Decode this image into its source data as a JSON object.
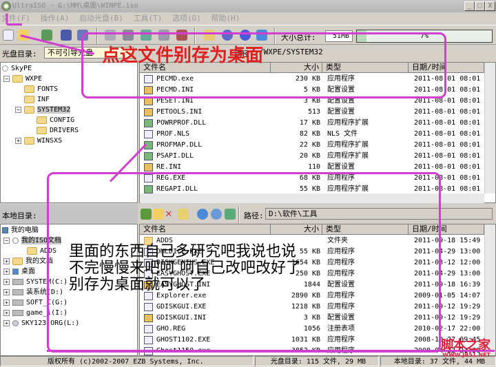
{
  "window": {
    "title": "UltraISO - G:\\MM\\桌面\\WINPE.iso"
  },
  "menu": [
    "文件(F)",
    "操作(A)",
    "启动光盘(B)",
    "工具(T)",
    "选项(O)",
    "帮助(H)"
  ],
  "toolbar": {
    "size_label": "大小总计:",
    "size_value": "51MB",
    "progress_text": "7%",
    "progress_percent": 7
  },
  "iso": {
    "label": "光盘目录:",
    "boot_value": "不可引导光盘",
    "path_label": "路径:",
    "path_value": "/WXPE/SYSTEM32"
  },
  "iso_tree": [
    "SkyPE",
    "WXPE",
    "FONTS",
    "INF",
    "SYSTEM32",
    "CONFIG",
    "DRIVERS",
    "WINSXS"
  ],
  "columns": {
    "name": "文件名",
    "size": "大小",
    "type": "类型",
    "date": "日期/时间"
  },
  "iso_files": [
    {
      "name": "PECMD.exe",
      "size": "230 KB",
      "type": "应用程序",
      "date": "2011-08-01 08:01"
    },
    {
      "name": "PECMD.INI",
      "size": "5 KB",
      "type": "配置设置",
      "date": "2011-08-01 08:01"
    },
    {
      "name": "PESET.INI",
      "size": "3 KB",
      "type": "配置设置",
      "date": "2011-08-01 08:01"
    },
    {
      "name": "PETOOLS.INI",
      "size": "513",
      "type": "配置设置",
      "date": "2011-08-01 08:01"
    },
    {
      "name": "POWRPROF.DLL",
      "size": "17 KB",
      "type": "应用程序扩展",
      "date": "2011-08-01 08:01"
    },
    {
      "name": "PROF.NLS",
      "size": "82 KB",
      "type": "NLS 文件",
      "date": "2011-08-01 08:01"
    },
    {
      "name": "PROFMAP.DLL",
      "size": "22 KB",
      "type": "应用程序扩展",
      "date": "2011-08-01 08:01"
    },
    {
      "name": "PSAPI.DLL",
      "size": "20 KB",
      "type": "应用程序扩展",
      "date": "2011-08-01 08:01"
    },
    {
      "name": "RE.INI",
      "size": "110",
      "type": "配置设置",
      "date": "2011-08-01 08:01"
    },
    {
      "name": "REG.EXE",
      "size": "68 KB",
      "type": "应用程序",
      "date": "2011-08-01 08:01"
    },
    {
      "name": "REGAPI.DLL",
      "size": "55 KB",
      "type": "应用程序扩展",
      "date": "2011-08-01 08:01"
    }
  ],
  "local": {
    "label": "本地目录:",
    "path_label": "路径:",
    "path_value": "D:\\软件\\工具"
  },
  "local_tree": [
    "我的电脑",
    "我的ISO文档",
    "ADDS",
    "我的文档",
    "桌面",
    "SYSTEM(C:)",
    "装系统(D:)",
    "SOFT_C(G:)",
    "game_i(I:)",
    "SKY123.ORG(L:)"
  ],
  "local_files": [
    {
      "name": "ADDS",
      "size": "",
      "type": "文件夹",
      "date": "2011-09-18 15:49"
    },
    {
      "name": "DMLDICE.EXE",
      "size": "55 KB",
      "type": "应用程序",
      "date": "2011-04-29 13:00"
    },
    {
      "name": "DISKGENIUS.EXE",
      "size": "1654 KB",
      "type": "应用程序",
      "date": "2011-03-12 12:00"
    },
    {
      "name": "EASYGHOST.EXE",
      "size": "250 KB",
      "type": "应用程序",
      "date": "2011-04-29 13:00"
    },
    {
      "name": "EASYGHOST.INI",
      "size": "1844",
      "type": "配置设置",
      "date": "2011-09-18 16:39"
    },
    {
      "name": "Explorer.exe",
      "size": "2890 KB",
      "type": "应用程序",
      "date": "2009-01-05 14:07"
    },
    {
      "name": "GDISKGUI.EXE",
      "size": "1218 KB",
      "type": "应用程序",
      "date": "2011-09-12 19:29"
    },
    {
      "name": "GDISKGUI.INI",
      "size": "3 KB",
      "type": "配置设置",
      "date": "2011-09-12 19:29"
    },
    {
      "name": "GHO.REG",
      "size": "1056",
      "type": "注册表项",
      "date": "2010-02-17 22:00"
    },
    {
      "name": "GHOST1102.EXE",
      "size": "1031 KB",
      "type": "应用程序",
      "date": "2008-10-27 09:45"
    },
    {
      "name": "Ghost1150.exe",
      "size": "3852 KB",
      "type": "应用程序",
      "date": "2008-04-22 21:38"
    }
  ],
  "status": {
    "copyright": "版权所有 (c)2002-2007 EZB Systems, Inc.",
    "iso_info": "光盘目录: 115 文件, 29 MB",
    "local_info": "本地目录: 37 文件, 44 MB"
  },
  "annotations": {
    "top": "点这文件别存为桌面",
    "bottom": "里面的东西自己多研究吧我说也说\n不完慢慢来吧呵 呵自己改吧改好了\n别存为桌面就可以了"
  },
  "watermark": {
    "name": "脚本之家",
    "url": "WWW.JB51.NET"
  },
  "colors": {
    "annotation": "#d13fd1",
    "annotation_text": "#e02020"
  }
}
